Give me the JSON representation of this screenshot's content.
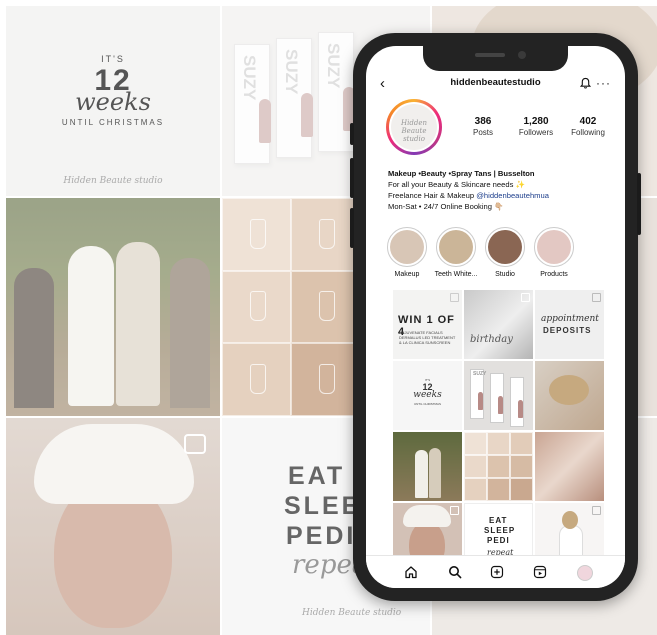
{
  "profile": {
    "username": "hiddenbeautestudio",
    "avatar_text": "Hidden Beaute studio",
    "stats": [
      {
        "value": "386",
        "label": "Posts"
      },
      {
        "value": "1,280",
        "label": "Followers"
      },
      {
        "value": "402",
        "label": "Following"
      }
    ],
    "bio_title": "Makeup •Beauty •Spray Tans | Busselton",
    "bio_line1": "For all your Beauty & Skincare needs ✨",
    "bio_line2_prefix": "Freelance Hair & Makeup ",
    "bio_line2_handle": "@hiddenbeautehmua",
    "bio_line3": "Mon-Sat • 24/7 Online Booking 👇🏼"
  },
  "highlights": [
    {
      "label": "Makeup",
      "color": "#d8c6b6"
    },
    {
      "label": "Teeth White...",
      "color": "#cbb598"
    },
    {
      "label": "Studio",
      "color": "#8a6653"
    },
    {
      "label": "Products",
      "color": "#e3c8c3"
    }
  ],
  "posts": {
    "win_title": "WIN 1 OF 4",
    "win_sub": "REJUVENATE FACIALS DERMALUS LED TREATMENT & LA CLINICA SUNSCREEN",
    "bday_text": "birthday",
    "dep_script": "appointment",
    "dep_caps": "DEPOSITS",
    "weeks_its": "IT'S",
    "weeks_num": "12",
    "weeks_word": "weeks",
    "weeks_until": "UNTIL CHRISTMAS",
    "box_label": "SUZY",
    "eat_lines": [
      "EAT",
      "SLEEP",
      "PEDI"
    ],
    "eat_repeat": "repeat"
  },
  "background": {
    "its": "IT'S",
    "number": "12",
    "weeks": "weeks",
    "until": "UNTIL CHRISTMAS",
    "mark": "Hidden Beaute studio",
    "box_label": "SUZY",
    "eat_lines": [
      "EAT",
      "SLEEP",
      "PEDI"
    ],
    "repeat": "repeat"
  },
  "icons": [
    "back-arrow-icon",
    "bell-icon",
    "more-icon",
    "home-icon",
    "search-icon",
    "add-icon",
    "reels-icon",
    "profile-avatar-icon"
  ],
  "colors": {
    "accent_handle": "#1e3f8c",
    "story_ring": [
      "#f9b233",
      "#ee2a7b",
      "#833ab4"
    ],
    "swatches": [
      "#efe2d6",
      "#e8d6c6",
      "#e2ccb9",
      "#ead9ca",
      "#dcc3ad",
      "#d6bba4",
      "#e5d1bf",
      "#d2b49c",
      "#c9a88f"
    ]
  }
}
